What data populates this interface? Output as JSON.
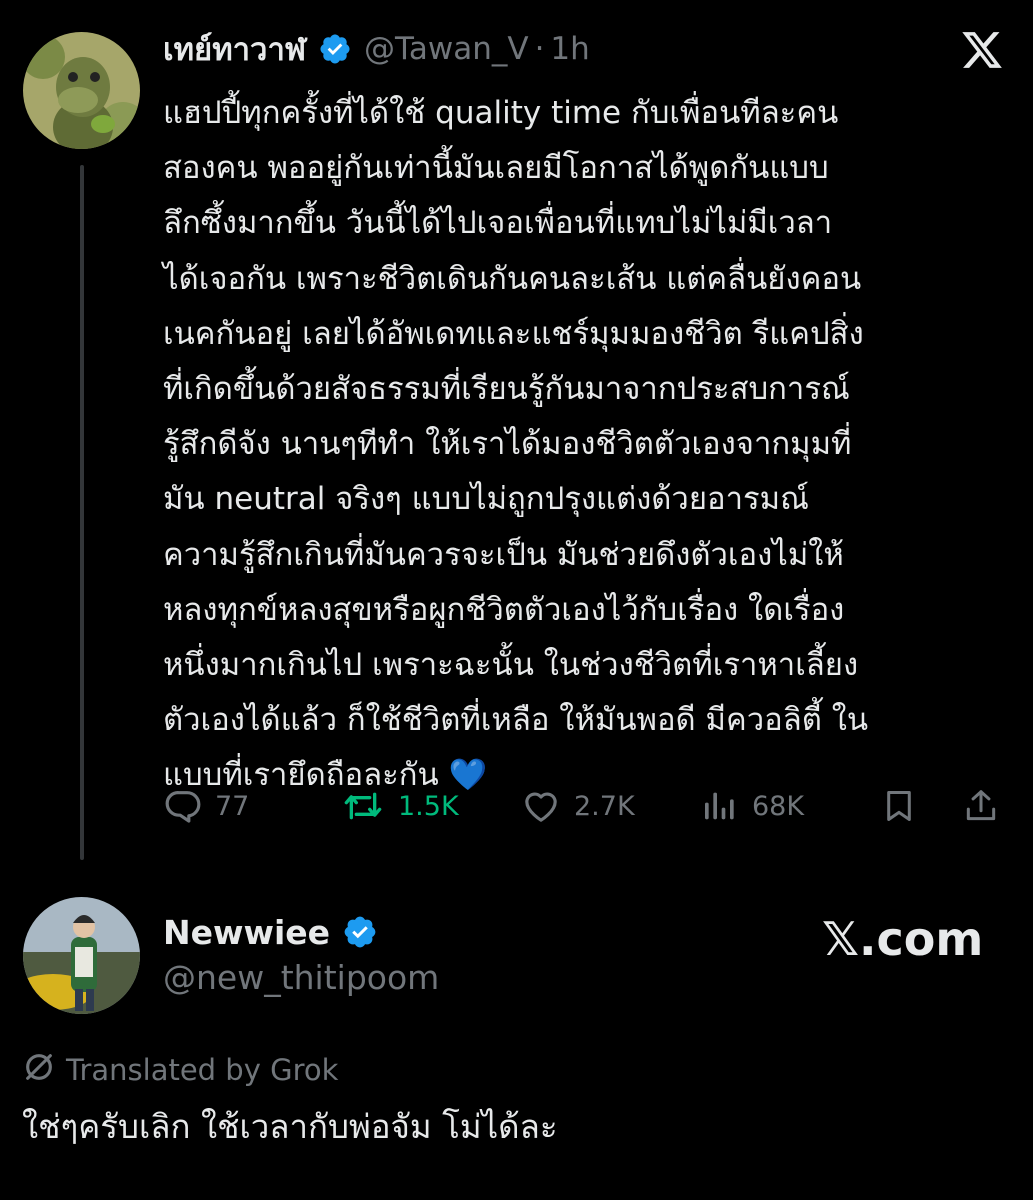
{
  "tweet": {
    "display_name": "เทย์ทาวาฬ",
    "handle": "@Tawan_V",
    "separator": "·",
    "time": "1h",
    "lines": [
      "แฮปปี้ทุกครั้งที่ได้ใช้ quality time กับเพื่อนทีละคน",
      "สองคน พออยู่กันเท่านี้มันเลยมีโอกาสได้พูดกันแบบ",
      "ลึกซึ้งมากขึ้น วันนี้ได้ไปเจอเพื่อนที่แทบไม่ไม่มีเวลา",
      "ได้เจอกัน เพราะชีวิตเดินกันคนละเส้น แต่คลื่นยังคอน",
      "เนคกันอยู่ เลยได้อัพเดทและแชร์มุมมองชีวิต รีแคปสิ่ง",
      "ที่เกิดขึ้นด้วยสัจธรรมที่เรียนรู้กันมาจากประสบการณ์",
      "รู้สึกดีจัง นานๆทีทำ ให้เราได้มองชีวิตตัวเองจากมุมที่",
      "มัน neutral จริงๆ แบบไม่ถูกปรุงแต่งด้วยอารมณ์",
      "ความรู้สึกเกินที่มันควรจะเป็น มันช่วยดึงตัวเองไม่ให้",
      "หลงทุกข์หลงสุขหรือผูกชีวิตตัวเองไว้กับเรื่อง ใดเรื่อง",
      "หนึ่งมากเกินไป เพราะฉะนั้น ในช่วงชีวิตที่เราหาเลี้ยง",
      "ตัวเองได้แล้ว ก็ใช้ชีวิตที่เหลือ ให้มันพอดี มีควอลิตี้ ใน",
      "แบบที่เรายึดถือละกัน 💙"
    ],
    "replies": "77",
    "reposts": "1.5K",
    "likes": "2.7K",
    "views": "68K"
  },
  "reply": {
    "display_name": "Newwiee",
    "handle": "@new_thitipoom",
    "brand": "𝕏.com",
    "translated_label": "Translated by Grok",
    "text": "ใช่ๆครับเลิก ใช้เวลากับพ่อจัม โม่ได้ละ"
  },
  "colors": {
    "background": "#000000",
    "text": "#e7e9ea",
    "muted": "#71767b",
    "verified": "#1d9bf0",
    "repost": "#00ba7c"
  },
  "icons": [
    "x-logo-icon",
    "verified-badge-icon",
    "reply-icon",
    "repost-icon",
    "like-icon",
    "views-icon",
    "bookmark-icon",
    "share-icon",
    "translate-icon"
  ]
}
